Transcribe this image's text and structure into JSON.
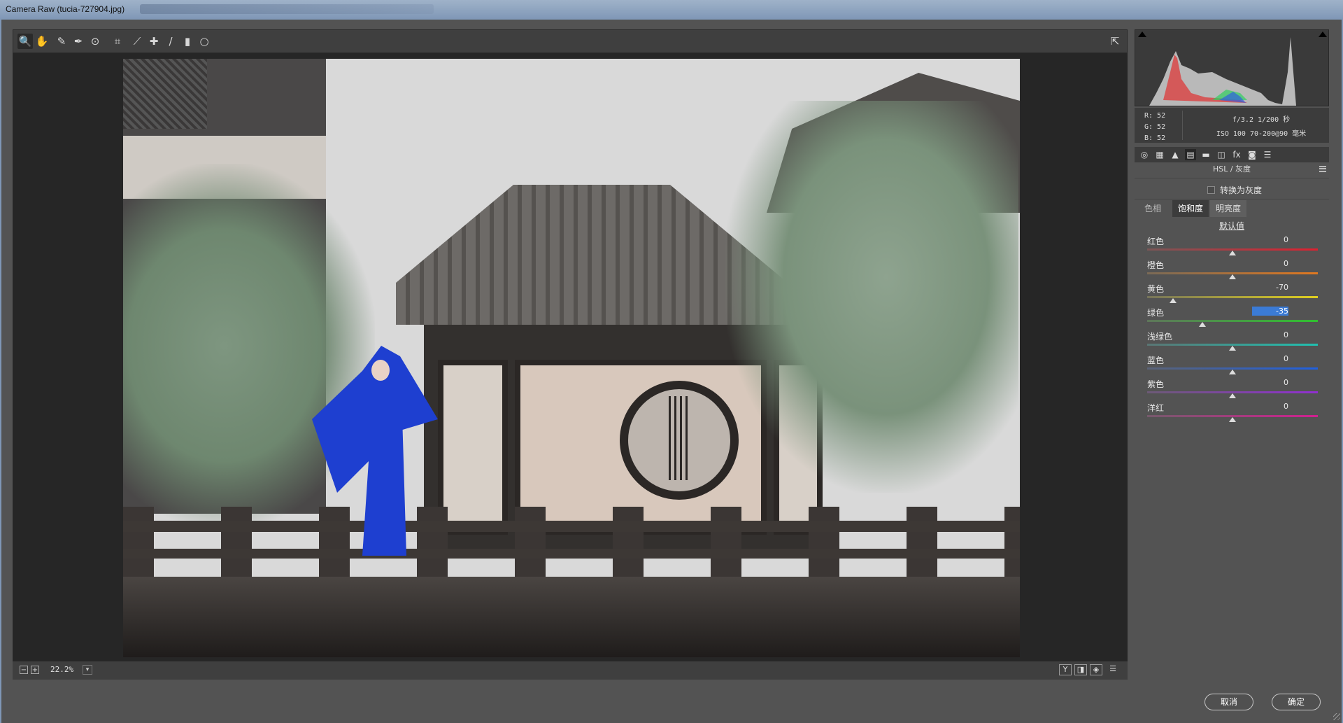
{
  "window": {
    "title": "Camera Raw (tucia-727904.jpg)"
  },
  "toolbar": {
    "tools": [
      {
        "name": "zoom-tool",
        "icon": "🔍"
      },
      {
        "name": "hand-tool",
        "icon": "✋"
      },
      {
        "name": "white-balance-tool",
        "icon": "✎"
      },
      {
        "name": "color-sampler-tool",
        "icon": "✒"
      },
      {
        "name": "targeted-adjustment-tool",
        "icon": "⊙"
      },
      {
        "name": "crop-tool",
        "icon": "⌗"
      },
      {
        "name": "straighten-tool",
        "icon": "⟋"
      },
      {
        "name": "spot-removal-tool",
        "icon": "✚"
      },
      {
        "name": "adjustment-brush-tool",
        "icon": "/"
      },
      {
        "name": "graduated-filter-tool",
        "icon": "▮"
      },
      {
        "name": "radial-filter-tool",
        "icon": "○"
      }
    ],
    "export_icon": "⇱"
  },
  "status": {
    "zoom": "22.2%",
    "minus": "−",
    "plus": "+",
    "dd": "▾",
    "view_buttons": [
      "Y",
      "◨",
      "◈",
      "☰"
    ]
  },
  "histogram": {
    "readout": {
      "r": "R:  52",
      "g": "G:  52",
      "b": "B:  52"
    },
    "camera": {
      "line1": "f/3.2  1/200 秒",
      "line2": "ISO 100  70-200@90 毫米"
    }
  },
  "panel_tabs": [
    "◎",
    "▦",
    "▲",
    "▤",
    "▬",
    "◫",
    "fx",
    "◙",
    "☰"
  ],
  "hsl": {
    "section_title": "HSL / 灰度",
    "convert_gray": "转换为灰度",
    "subtabs": [
      "色相",
      "饱和度",
      "明亮度"
    ],
    "defaults_link": "默认值",
    "sliders": [
      {
        "label": "红色",
        "value": "0",
        "num": 0,
        "gradient": "linear-gradient(90deg,#7a5656,#e02030)"
      },
      {
        "label": "橙色",
        "value": "0",
        "num": 0,
        "gradient": "linear-gradient(90deg,#7a6a56,#e07820)"
      },
      {
        "label": "黄色",
        "value": "-70",
        "num": -70,
        "gradient": "linear-gradient(90deg,#76745a,#e0d020)"
      },
      {
        "label": "绿色",
        "value": "-35",
        "num": -35,
        "gradient": "linear-gradient(90deg,#5e765a,#30c030)",
        "selected": true
      },
      {
        "label": "浅绿色",
        "value": "0",
        "num": 0,
        "gradient": "linear-gradient(90deg,#5a7674,#20c0b0)"
      },
      {
        "label": "蓝色",
        "value": "0",
        "num": 0,
        "gradient": "linear-gradient(90deg,#5a6276,#2060e0)"
      },
      {
        "label": "紫色",
        "value": "0",
        "num": 0,
        "gradient": "linear-gradient(90deg,#6c5a76,#9030d0)"
      },
      {
        "label": "洋红",
        "value": "0",
        "num": 0,
        "gradient": "linear-gradient(90deg,#765a6c,#d02090)"
      }
    ]
  },
  "buttons": {
    "cancel": "取消",
    "ok": "确定"
  },
  "slider_range": [
    -100,
    100
  ]
}
